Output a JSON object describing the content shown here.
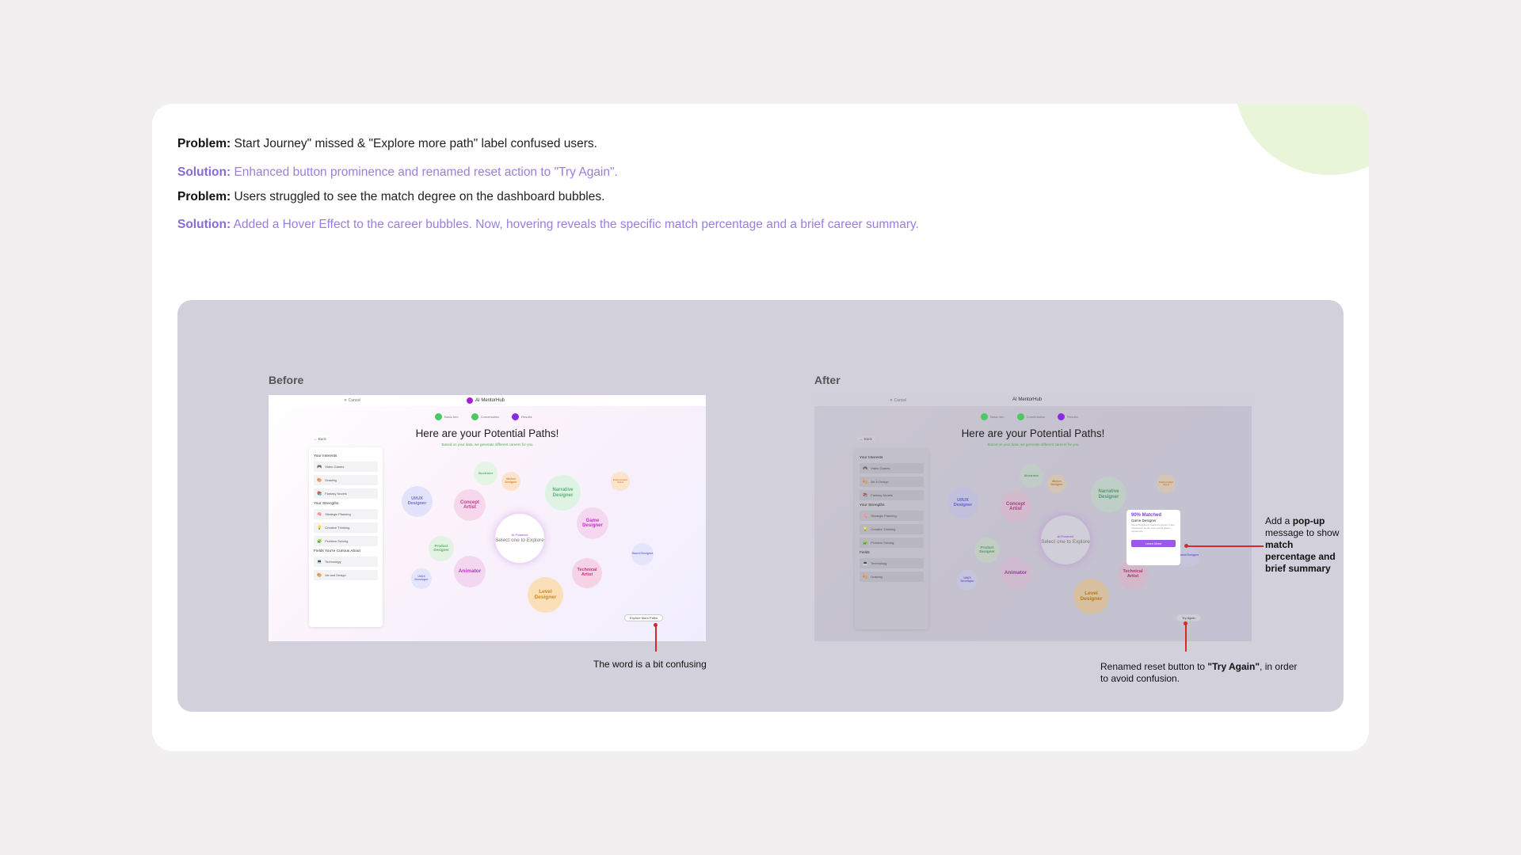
{
  "notes": [
    {
      "kind": "problem",
      "label": "Problem:",
      "text": "Start Journey\" missed & \"Explore more path\" label confused users."
    },
    {
      "kind": "solution",
      "label": "Solution:",
      "text": "Enhanced button prominence and renamed reset action to \"Try Again\"."
    },
    {
      "kind": "problem",
      "label": "Problem:",
      "text": "Users struggled to see the match degree on the dashboard bubbles."
    },
    {
      "kind": "solution",
      "label": "Solution:",
      "text": "Added a Hover Effect to the career bubbles. Now, hovering reveals the specific match percentage and a brief career summary."
    }
  ],
  "before": {
    "label": "Before",
    "cancel": "Cancel",
    "brand": "AI MentorHub",
    "steps": [
      "Basic Info",
      "Conversation",
      "Results"
    ],
    "title": "Here are your Potential Paths!",
    "subtitle": "Based on your data, we generate different careers for you",
    "back": "Back",
    "panel": [
      {
        "heading": "Your Interests",
        "items": [
          {
            "icon": "🎮",
            "label": "Video Games"
          },
          {
            "icon": "🎨",
            "label": "Drawing"
          },
          {
            "icon": "📚",
            "label": "Fantasy Novels"
          }
        ]
      },
      {
        "heading": "Your Strengths",
        "items": [
          {
            "icon": "🧠",
            "label": "Strategic Planning"
          },
          {
            "icon": "💡",
            "label": "Creative Thinking"
          },
          {
            "icon": "🧩",
            "label": "Problem Solving"
          }
        ]
      },
      {
        "heading": "Fields You're Curious About",
        "items": [
          {
            "icon": "💻",
            "label": "Technology"
          },
          {
            "icon": "🎨",
            "label": "Art and Design"
          }
        ]
      }
    ],
    "center": {
      "ai": "AI Powered",
      "text": "Select one to Explore"
    },
    "bubbles": [
      "Illustrator",
      "Motion Designer",
      "Narrative Designer",
      "Environment Artist",
      "UI/UX Designer",
      "Concept Artist",
      "Game Designer",
      "Product Designer",
      "Sound Designer",
      "Animator",
      "Technical Artist",
      "UI/UX Developer",
      "Level Designer"
    ],
    "reset_button": "Explore More Paths",
    "annotation": "The word is a bit confusing"
  },
  "after": {
    "label": "After",
    "cancel": "Cancel",
    "brand": "AI MentorHub",
    "steps": [
      "Basic Info",
      "Conversation",
      "Results"
    ],
    "title": "Here are your Potential Paths!",
    "subtitle": "Based on your data, we generate different careers for you",
    "back": "Back",
    "panel": [
      {
        "heading": "Your Interests",
        "items": [
          {
            "icon": "🎮",
            "label": "Video Games"
          },
          {
            "icon": "🎨",
            "label": "Art & Design"
          },
          {
            "icon": "📚",
            "label": "Fantasy Novels"
          }
        ]
      },
      {
        "heading": "Your Strengths",
        "items": [
          {
            "icon": "🧠",
            "label": "Strategic Planning"
          },
          {
            "icon": "💡",
            "label": "Creative Thinking"
          },
          {
            "icon": "🧩",
            "label": "Problem Solving"
          }
        ]
      },
      {
        "heading": "Fields",
        "items": [
          {
            "icon": "💻",
            "label": "Technology"
          },
          {
            "icon": "🎨",
            "label": "Drawing"
          }
        ]
      }
    ],
    "center": {
      "ai": "AI Powered",
      "text": "Select one to Explore"
    },
    "bubbles": [
      "Illustrator",
      "Motion Designer",
      "Narrative Designer",
      "Environment Artist",
      "UI/UX Designer",
      "Concept Artist",
      "Product Designer",
      "Sound Designer",
      "Animator",
      "Technical Artist",
      "UI/UX Developer",
      "Level Designer"
    ],
    "popup": {
      "percent": "90% Matched",
      "role": "Game Designer",
      "desc": "Game Designers create the game's rules, mechanics, levels, and overall player experience.",
      "button": "Learn More"
    },
    "reset_button": "Try Again",
    "popup_annotation": [
      {
        "text": "Add a ",
        "bold": false
      },
      {
        "text": "pop-up",
        "bold": true
      },
      {
        "text": " message to show ",
        "bold": false
      },
      {
        "text": "match percentage and brief summary",
        "bold": true
      }
    ],
    "reset_annotation": [
      {
        "text": "Renamed reset button to ",
        "bold": false
      },
      {
        "text": "\"Try Again\"",
        "bold": true
      },
      {
        "text": ", in order to avoid confusion.",
        "bold": false
      }
    ]
  },
  "colors": {
    "accent_purple": "#8a6ad8",
    "annotation_red": "#d42a2a",
    "stage_bg": "#d2d0db"
  }
}
